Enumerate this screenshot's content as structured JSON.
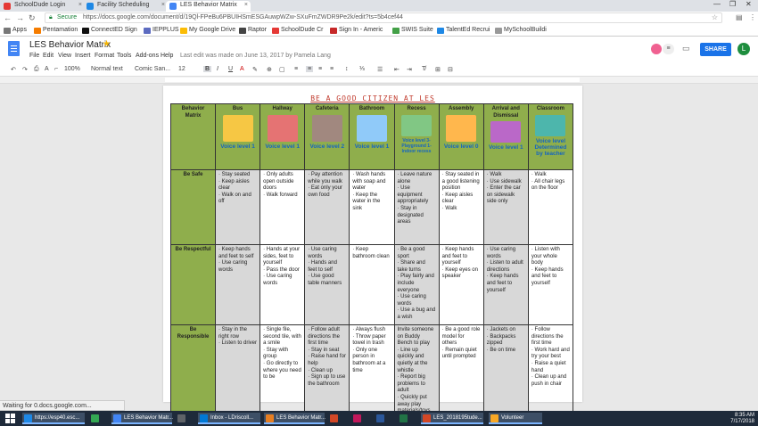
{
  "browser": {
    "tabs": [
      {
        "label": "SchoolDude Login",
        "color": "#e53935"
      },
      {
        "label": "Facility Scheduling",
        "color": "#1e88e5"
      },
      {
        "label": "LES Behavior Matrix",
        "color": "#4285f4"
      }
    ],
    "address": {
      "secure_label": "Secure",
      "url": "https://docs.google.com/document/d/19Ql-FPeBu6PBUIHSmESGAuwpWZw-SXuFmZWDR9Pe2k/edit?ts=5b4cef44"
    },
    "bookmarks": [
      {
        "label": "Apps",
        "color": "#777"
      },
      {
        "label": "Pentamation",
        "color": "#f57c00"
      },
      {
        "label": "ConnectED Sign",
        "color": "#111"
      },
      {
        "label": "IEPPLUS",
        "color": "#5c6bc0"
      },
      {
        "label": "My Google Drive",
        "color": "#fbbc05"
      },
      {
        "label": "Raptor",
        "color": "#444"
      },
      {
        "label": "SchoolDude Cr",
        "color": "#e53935"
      },
      {
        "label": "Sign In - Americ",
        "color": "#c62828"
      },
      {
        "label": "SWIS Suite",
        "color": "#43a047"
      },
      {
        "label": "TalentEd Recrui",
        "color": "#1e88e5"
      },
      {
        "label": "MySchoolBuildi",
        "color": "#999"
      }
    ]
  },
  "docs": {
    "title": "LES Behavior Matrix",
    "menus": [
      "File",
      "Edit",
      "View",
      "Insert",
      "Format",
      "Tools",
      "Add-ons",
      "Help"
    ],
    "last_edit": "Last edit was made on June 13, 2017 by Pamela Lang",
    "share_label": "SHARE",
    "avatar_letter": "L",
    "toolbar": {
      "zoom": "100%",
      "style": "Normal text",
      "font": "Comic San...",
      "size": "12"
    }
  },
  "document": {
    "heading": "BE A GOOD CITIZEN AT LES",
    "corner": "Behavior Matrix",
    "columns": [
      {
        "title": "Bus",
        "voice": "Voice level 1",
        "pic": "#f6c744"
      },
      {
        "title": "Hallway",
        "voice": "Voice level 1",
        "pic": "#e57373"
      },
      {
        "title": "Cafeteria",
        "voice": "Voice level 2",
        "pic": "#a1887f"
      },
      {
        "title": "Bathroom",
        "voice": "Voice level 1",
        "pic": "#90caf9"
      },
      {
        "title": "Recess",
        "voice": "Voice level 3-Playground 1-Indoor recess",
        "pic": "#81c784"
      },
      {
        "title": "Assembly",
        "voice": "Voice level 0",
        "pic": "#ffb74d"
      },
      {
        "title": "Arrival and Dismissal",
        "voice": "Voice level 1",
        "pic": "#ba68c8"
      },
      {
        "title": "Classroom",
        "voice": "Voice level Determined by teacher",
        "pic": "#4db6ac"
      }
    ],
    "rows": [
      {
        "label": "Be Safe",
        "cells": [
          "· Stay seated\n· Keep aisles clear\n· Walk on and off",
          "· Only adults open outside doors\n· Walk forward",
          "· Pay attention while you walk\n· Eat only your own food",
          "· Wash hands with soap and water\n· Keep the water in the sink",
          "· Leave nature alone\n· Use equipment appropriately\n· Stay in designated areas",
          "· Stay seated in a good listening position\n· Keep aisles clear\n· Walk",
          "· Walk\n· Use sidewalk\n· Enter the car on sidewalk side only",
          "· Walk\n· All chair legs on the floor"
        ]
      },
      {
        "label": "Be Respectful",
        "cells": [
          "· Keep hands and feet to self\n· Use caring words",
          "· Hands at your sides, feet to yourself\n· Pass the door\n· Use caring words",
          "· Use caring words\n· Hands and feet to self\n· Use good table manners",
          "· Keep bathroom clean",
          "· Be a good sport\n· Share and take turns\n· Play fairly and include everyone\n· Use caring words\n· Use a bug and a wish",
          "· Keep hands and feet to yourself\n· Keep eyes on speaker",
          "· Use caring words\n· Listen to adult directions\n· Keep hands and feet to yourself",
          "· Listen with your whole body\n· Keep hands and feet to yourself"
        ]
      },
      {
        "label": "Be Responsible",
        "cells": [
          "· Stay in the right row\n· Listen to driver",
          "· Single file, second tile, with a smile\n· Stay with group\n· Go directly to where you need to be",
          "· Follow adult directions the first time\n· Stay in seat\n· Raise hand for help\n· Clean up\n· Sign up to use the bathroom",
          "· Always flush\n· Throw paper towel in trash\n· Only one person in bathroom at a time",
          "Invite someone on Buddy Bench to play\n· Line up quickly and quietly at the whistle\n· Report big problems to adult\n· Quickly put away play materials/toys",
          "· Be a good role model for others\n· Remain quiet until prompted",
          "· Jackets on\n· Backpacks zipped\n· Be on time",
          "· Follow directions the first time\n· Work hard and try your best\n· Raise a quiet hand\n· Clean up and push in chair"
        ]
      }
    ]
  },
  "status": "Waiting for 0.docs.google.com...",
  "taskbar": {
    "items": [
      {
        "label": "https://esp40.esc...",
        "color": "#1e88e5"
      },
      {
        "label": "",
        "color": "#34a853"
      },
      {
        "label": "LES Behavior Matr...",
        "color": "#4285f4"
      },
      {
        "label": "",
        "color": "#5f6368"
      },
      {
        "label": "Inbox - LDriscoll...",
        "color": "#0078d4"
      },
      {
        "label": "LES Behavior Matr...",
        "color": "#e67e22"
      },
      {
        "label": "",
        "color": "#d24726"
      },
      {
        "label": "",
        "color": "#c2185b"
      },
      {
        "label": "",
        "color": "#2b579a"
      },
      {
        "label": "",
        "color": "#217346"
      },
      {
        "label": "LES_2018195tude...",
        "color": "#d24726"
      },
      {
        "label": "Volunteer",
        "color": "#f9a825"
      }
    ],
    "time": "8:35 AM",
    "date": "7/17/2018"
  }
}
